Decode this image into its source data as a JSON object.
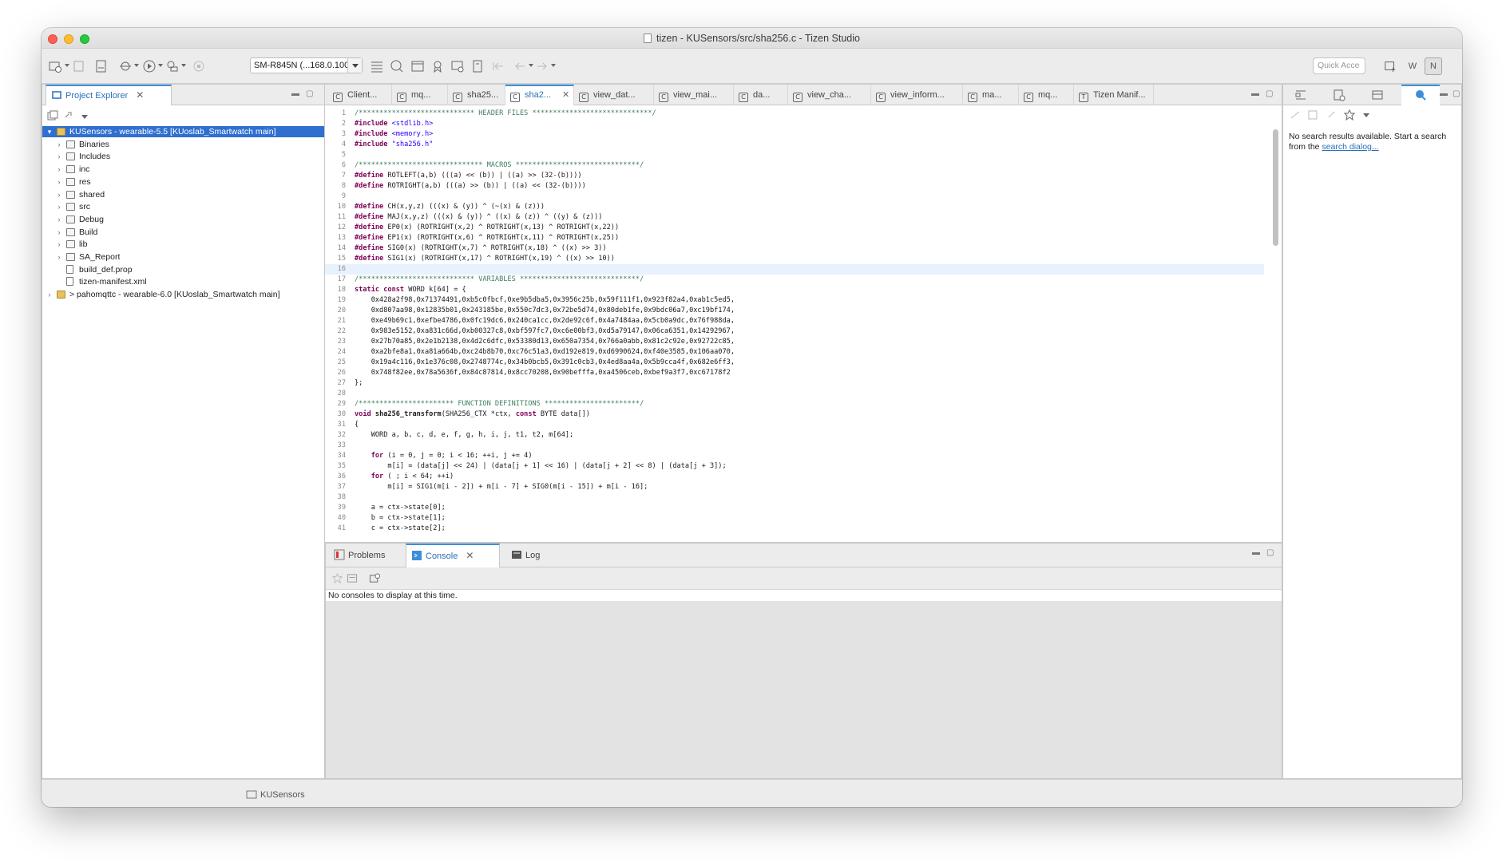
{
  "window": {
    "title": "tizen - KUSensors/src/sha256.c - Tizen Studio"
  },
  "toolbar": {
    "device": "SM-R845N (...168.0.100)",
    "quick_access_placeholder": "Quick Acce",
    "perspectives": [
      "W",
      "N"
    ]
  },
  "project_explorer": {
    "tab_label": "Project Explorer",
    "items": [
      {
        "label": "KUSensors - wearable-5.5 [KUoslab_Smartwatch main]",
        "level": 0,
        "selected": true,
        "expanded": true
      },
      {
        "label": "Binaries",
        "level": 1
      },
      {
        "label": "Includes",
        "level": 1
      },
      {
        "label": "inc",
        "level": 1
      },
      {
        "label": "res",
        "level": 1
      },
      {
        "label": "shared",
        "level": 1
      },
      {
        "label": "src",
        "level": 1
      },
      {
        "label": "Debug",
        "level": 1
      },
      {
        "label": "Build",
        "level": 1
      },
      {
        "label": "lib",
        "level": 1
      },
      {
        "label": "SA_Report",
        "level": 1
      },
      {
        "label": "build_def.prop",
        "level": 1,
        "file": true
      },
      {
        "label": "tizen-manifest.xml",
        "level": 1,
        "file": true
      },
      {
        "label": "> pahomqttc - wearable-6.0 [KUoslab_Smartwatch main]",
        "level": 0
      }
    ]
  },
  "editor": {
    "tabs": [
      {
        "label": "Client...",
        "icon": "C"
      },
      {
        "label": "mq...",
        "icon": "C"
      },
      {
        "label": "sha25...",
        "icon": "C"
      },
      {
        "label": "sha2...",
        "icon": "C",
        "active": true
      },
      {
        "label": "view_dat...",
        "icon": "C"
      },
      {
        "label": "view_mai...",
        "icon": "C"
      },
      {
        "label": "da...",
        "icon": "C"
      },
      {
        "label": "view_cha...",
        "icon": "C"
      },
      {
        "label": "view_inform...",
        "icon": "C"
      },
      {
        "label": "ma...",
        "icon": "C"
      },
      {
        "label": "mq...",
        "icon": "C"
      },
      {
        "label": "Tizen Manif...",
        "icon": "T"
      }
    ],
    "lines": [
      "/**************************** HEADER FILES *****************************/",
      "#include <stdlib.h>",
      "#include <memory.h>",
      "#include \"sha256.h\"",
      "",
      "/****************************** MACROS ******************************/",
      "#define ROTLEFT(a,b) (((a) << (b)) | ((a) >> (32-(b))))",
      "#define ROTRIGHT(a,b) (((a) >> (b)) | ((a) << (32-(b))))",
      "",
      "#define CH(x,y,z) (((x) & (y)) ^ (~(x) & (z)))",
      "#define MAJ(x,y,z) (((x) & (y)) ^ ((x) & (z)) ^ ((y) & (z)))",
      "#define EP0(x) (ROTRIGHT(x,2) ^ ROTRIGHT(x,13) ^ ROTRIGHT(x,22))",
      "#define EP1(x) (ROTRIGHT(x,6) ^ ROTRIGHT(x,11) ^ ROTRIGHT(x,25))",
      "#define SIG0(x) (ROTRIGHT(x,7) ^ ROTRIGHT(x,18) ^ ((x) >> 3))",
      "#define SIG1(x) (ROTRIGHT(x,17) ^ ROTRIGHT(x,19) ^ ((x) >> 10))",
      "",
      "/**************************** VARIABLES *****************************/",
      "static const WORD k[64] = {",
      "    0x428a2f98,0x71374491,0xb5c0fbcf,0xe9b5dba5,0x3956c25b,0x59f111f1,0x923f82a4,0xab1c5ed5,",
      "    0xd807aa98,0x12835b01,0x243185be,0x550c7dc3,0x72be5d74,0x80deb1fe,0x9bdc06a7,0xc19bf174,",
      "    0xe49b69c1,0xefbe4786,0x0fc19dc6,0x240ca1cc,0x2de92c6f,0x4a7484aa,0x5cb0a9dc,0x76f988da,",
      "    0x983e5152,0xa831c66d,0xb00327c8,0xbf597fc7,0xc6e00bf3,0xd5a79147,0x06ca6351,0x14292967,",
      "    0x27b70a85,0x2e1b2138,0x4d2c6dfc,0x53380d13,0x650a7354,0x766a0abb,0x81c2c92e,0x92722c85,",
      "    0xa2bfe8a1,0xa81a664b,0xc24b8b70,0xc76c51a3,0xd192e819,0xd6990624,0xf40e3585,0x106aa070,",
      "    0x19a4c116,0x1e376c08,0x2748774c,0x34b0bcb5,0x391c0cb3,0x4ed8aa4a,0x5b9cca4f,0x682e6ff3,",
      "    0x748f82ee,0x78a5636f,0x84c87814,0x8cc70208,0x90befffa,0xa4506ceb,0xbef9a3f7,0xc67178f2",
      "};",
      "",
      "/*********************** FUNCTION DEFINITIONS ***********************/",
      "void sha256_transform(SHA256_CTX *ctx, const BYTE data[])",
      "{",
      "    WORD a, b, c, d, e, f, g, h, i, j, t1, t2, m[64];",
      "",
      "    for (i = 0, j = 0; i < 16; ++i, j += 4)",
      "        m[i] = (data[j] << 24) | (data[j + 1] << 16) | (data[j + 2] << 8) | (data[j + 3]);",
      "    for ( ; i < 64; ++i)",
      "        m[i] = SIG1(m[i - 2]) + m[i - 7] + SIG0(m[i - 15]) + m[i - 16];",
      "",
      "    a = ctx->state[0];",
      "    b = ctx->state[1];",
      "    c = ctx->state[2];"
    ]
  },
  "search_view": {
    "message": "No search results available. Start a search from the",
    "link": "search dialog..."
  },
  "bottom_panel": {
    "tabs": [
      {
        "label": "Problems"
      },
      {
        "label": "Console",
        "active": true
      },
      {
        "label": "Log"
      }
    ],
    "console_message": "No consoles to display at this time."
  },
  "status_bar": {
    "label": "KUSensors"
  },
  "colors": {
    "accent": "#3d8eda",
    "selection": "#2f6fd0",
    "comment": "#3f7f5f",
    "keyword": "#7f0055",
    "string": "#2a00ff"
  }
}
